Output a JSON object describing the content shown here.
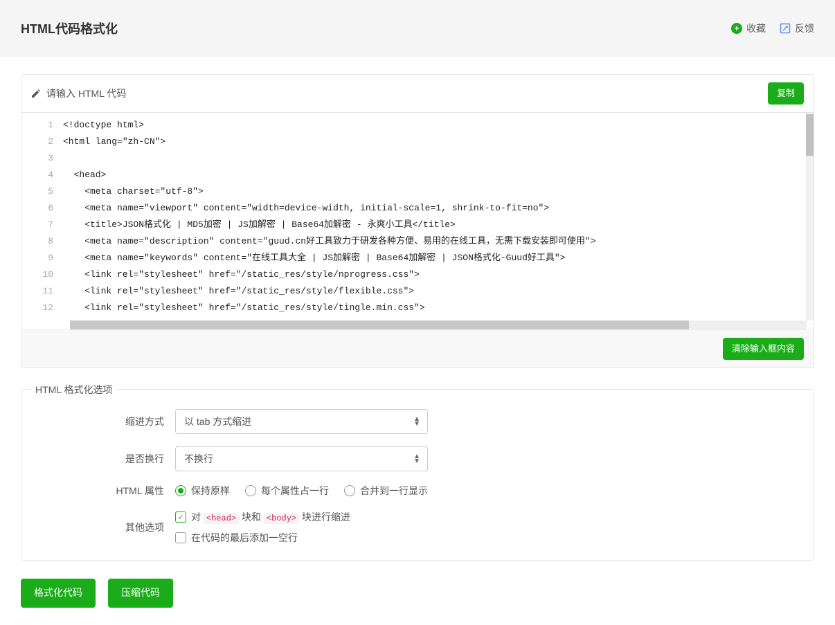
{
  "header": {
    "title": "HTML代码格式化",
    "favorite_label": "收藏",
    "feedback_label": "反馈"
  },
  "input_panel": {
    "title": "请输入 HTML 代码",
    "copy_btn": "复制",
    "clear_btn": "清除输入框内容",
    "lines": [
      "<!doctype html>",
      "<html lang=\"zh-CN\">",
      "",
      "  <head>",
      "    <meta charset=\"utf-8\">",
      "    <meta name=\"viewport\" content=\"width=device-width, initial-scale=1, shrink-to-fit=no\">",
      "    <title>JSON格式化 | MD5加密 | JS加解密 | Base64加解密 - 永爽小工具</title>",
      "    <meta name=\"description\" content=\"guud.cn好工具致力于研发各种方便、易用的在线工具，无需下载安装即可使用\">",
      "    <meta name=\"keywords\" content=\"在线工具大全 | JS加解密 | Base64加解密 | JSON格式化-Guud好工具\">",
      "    <link rel=\"stylesheet\" href=\"/static_res/style/nprogress.css\">",
      "    <link rel=\"stylesheet\" href=\"/static_res/style/flexible.css\">",
      "    <link rel=\"stylesheet\" href=\"/static_res/style/tingle.min.css\">"
    ]
  },
  "options": {
    "legend": "HTML 格式化选项",
    "indent_label": "缩进方式",
    "indent_value": "以 tab 方式缩进",
    "wrap_label": "是否换行",
    "wrap_value": "不换行",
    "attr_label": "HTML 属性",
    "attr_radio_keep": "保持原样",
    "attr_radio_perline": "每个属性占一行",
    "attr_radio_merge": "合并到一行显示",
    "other_label": "其他选项",
    "check_indent_prefix": "对",
    "check_indent_mid": "块和",
    "check_indent_suffix": "块进行缩进",
    "check_blankline": "在代码的最后添加一空行",
    "tag_head": "<head>",
    "tag_body": "<body>"
  },
  "buttons": {
    "format": "格式化代码",
    "minify": "压缩代码"
  }
}
